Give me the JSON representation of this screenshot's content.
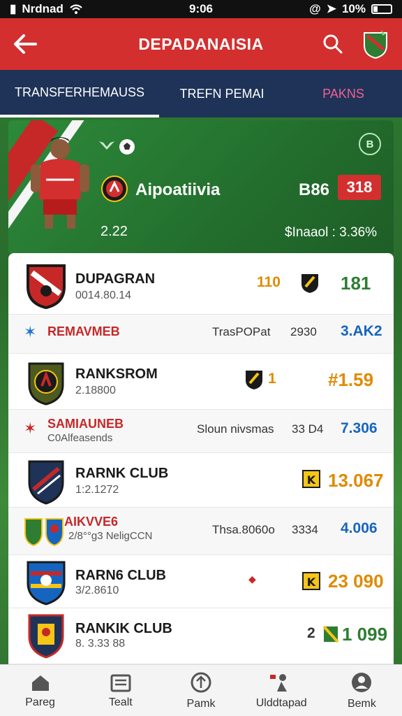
{
  "status": {
    "carrier": "Nrdnad",
    "time": "9:06",
    "battery": "10%"
  },
  "header": {
    "title": "DEPADANAISIA"
  },
  "tabs": [
    {
      "label": "TRANSFERHEMAUSS",
      "active": true
    },
    {
      "label": "TREFN PEMAI",
      "active": false
    },
    {
      "label": "PAKNS",
      "active": false
    }
  ],
  "hero": {
    "club_name": "Aipoatiivia",
    "score_a": "B86",
    "score_b": "318",
    "left_number": "2.22",
    "right_stat": "$Inaaol : 3.36%",
    "corner_icon_text": "B"
  },
  "rows": [
    {
      "kind": "club",
      "name": "DUPAGRAN",
      "sub": "0014.80.14",
      "points": "110",
      "value": "181",
      "value_color": "green"
    },
    {
      "kind": "transfer",
      "title": "REMAVMEB",
      "sub": "",
      "type": "TrasPOPat",
      "fee": "2930",
      "value": "3.AK2"
    },
    {
      "kind": "club",
      "name": "RANKSROM",
      "sub": "2.18800",
      "points": "1",
      "value": "#1.59",
      "value_color": "amber"
    },
    {
      "kind": "transfer",
      "title": "SAMIAUNEB",
      "sub": "C0Alfeasends",
      "type": "Sloun nivsmas",
      "fee": "33 D4",
      "value": "7.306"
    },
    {
      "kind": "club",
      "name": "RARNK CLUB",
      "sub": "1:2.1272",
      "points": "",
      "value": "13.067",
      "value_color": "amber"
    },
    {
      "kind": "transfer",
      "title": "AIKVVE6",
      "sub": "2/8°°g3 NeligCCN",
      "type": "Thsa.8060o",
      "fee": "3334",
      "value": "4.006"
    },
    {
      "kind": "club",
      "name": "RARN6 CLUB",
      "sub": "3/2.8610",
      "points": "",
      "value": "23 090",
      "value_color": "amber"
    },
    {
      "kind": "club",
      "name": "RANKIK CLUB",
      "sub": "8. 3.33 88",
      "points": "2",
      "value": "1 099",
      "value_color": "green"
    }
  ],
  "nav": [
    {
      "label": "Pareg",
      "icon": "home-icon"
    },
    {
      "label": "Tealt",
      "icon": "news-icon"
    },
    {
      "label": "Pamk",
      "icon": "compass-icon"
    },
    {
      "label": "Ulddtapad",
      "icon": "transfer-icon"
    },
    {
      "label": "Bemk",
      "icon": "profile-icon"
    }
  ],
  "colors": {
    "header": "#d32f2f",
    "tabs": "#1f3358",
    "pitch": "#2e7d32",
    "value_green": "#2e7d32",
    "value_amber": "#e08a00",
    "value_blue": "#1565c0"
  }
}
